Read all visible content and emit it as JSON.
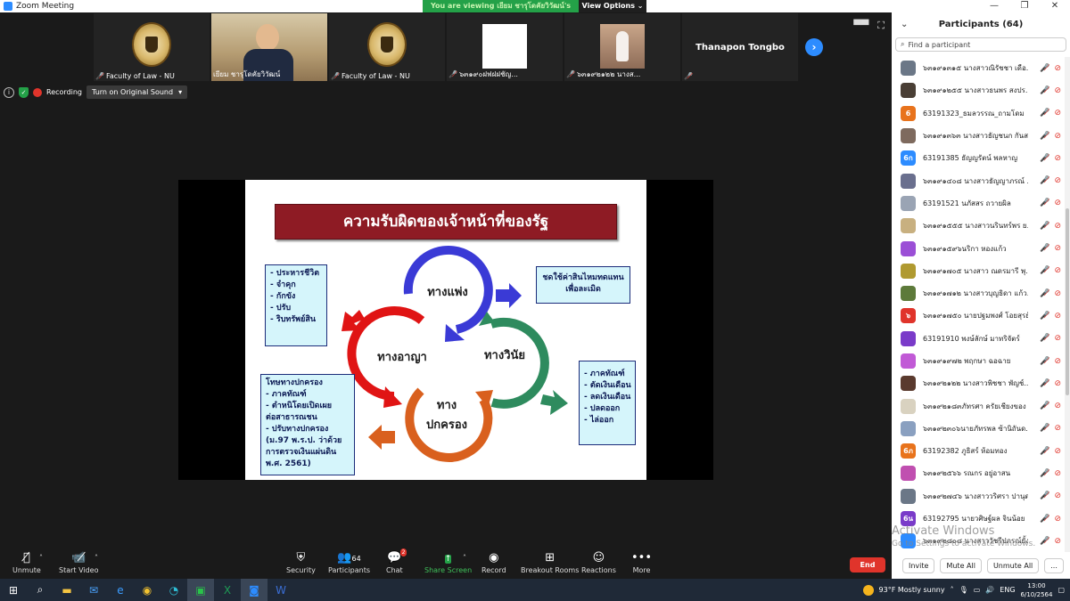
{
  "window": {
    "title": "Zoom Meeting",
    "controls": [
      "—",
      "❐",
      "✕"
    ]
  },
  "share_banner": {
    "viewing": "You are viewing เยียม ชารุโดคัยวิวัฒน์'s screen",
    "options": "View Options ⌄"
  },
  "gallery": [
    {
      "name": "Faculty of Law - NU",
      "kind": "seal"
    },
    {
      "name": "เยียม ชารุโดคัยวิวัฒน์",
      "kind": "person",
      "active": true
    },
    {
      "name": "Faculty of Law - NU",
      "kind": "seal"
    },
    {
      "name": "๖๓๑๙๐ฝฟฝฝชัญ...",
      "kind": "white"
    },
    {
      "name": "๖๓๑๙๒๑๒๒ นางส...",
      "kind": "girl"
    },
    {
      "name": "Thanapon Tongbo",
      "kind": "name"
    }
  ],
  "status_row": {
    "info_icon": "i",
    "recording": "Recording",
    "original_sound": "Turn on Original Sound"
  },
  "slide": {
    "title": "ความรับผิดของเจ้าหน้าที่ของรัฐ",
    "cycle": {
      "civil": "ทางแพ่ง",
      "criminal": "ทางอาญา",
      "discipline": "ทางวินัย",
      "admin_line1": "ทาง",
      "admin_line2": "ปกครอง"
    },
    "criminal_box": [
      "- ประหารชีวิต",
      "- จำคุก",
      "- กักขัง",
      "- ปรับ",
      "- ริบทรัพย์สิน"
    ],
    "civil_box": [
      "ชดใช้ค่าสินไหมทดแทน",
      "เพื่อละเมิด"
    ],
    "discipline_box": [
      "- ภาคทัณฑ์",
      "- ตัดเงินเดือน",
      "- ลดเงินเดือน",
      "- ปลดออก",
      "- ไล่ออก"
    ],
    "admin_box": [
      "โทษทางปกครอง",
      "- ภาคทัณฑ์",
      "- ตำหนิโดยเปิดเผย",
      "  ต่อสาธารณชน",
      "- ปรับทางปกครอง",
      "(ม.97  พ.ร.ป. ว่าด้วย",
      "การตรวจเงินแผ่นดิน",
      "พ.ศ. 2561)"
    ]
  },
  "participants_panel": {
    "title": "Participants (64)",
    "search_placeholder": "Find a participant",
    "participants": [
      {
        "initial": "",
        "color": "#6b7787",
        "name": "๖๓๑๙๑๓๑๕ นางสาวณิรัชชา เดือ..."
      },
      {
        "initial": "",
        "color": "#4a3f35",
        "name": "๖๓๑๙๑๒๕๕ นางสาวธนพร สงปร..."
      },
      {
        "initial": "6",
        "color": "#e8731c",
        "name": "63191323_ธมลวรรณ_ถามโดม"
      },
      {
        "initial": "",
        "color": "#7e6a5e",
        "name": "๖๓๑๙๑๓๖๓ นางสาวธัญชนก กันส..."
      },
      {
        "initial": "6ก",
        "color": "#2d8cff",
        "name": "63191385 ธัญญรัตน์ พลหาญ"
      },
      {
        "initial": "",
        "color": "#6a6f8e",
        "name": "๖๓๑๙๑๔๐๘ นางสาวธัญญาภรณ์ ..."
      },
      {
        "initial": "",
        "color": "#9aa4b4",
        "name": "63191521 นภัสสร ถวายผิล"
      },
      {
        "initial": "",
        "color": "#c8b080",
        "name": "๖๓๑๙๑๕๕๕ นางสาวนรินทร์พร ย..."
      },
      {
        "initial": "",
        "color": "#9b4fd6",
        "name": "๖๓๑๙๑๕๙๖นริกา หองแก้ว"
      },
      {
        "initial": "",
        "color": "#b09a30",
        "name": "๖๓๑๙๑๗๐๕ นางสาว ณดรมารี พุ..."
      },
      {
        "initial": "",
        "color": "#5d7a3a",
        "name": "๖๓๑๙๑๗๑๒ นางสาวบุญธิดา แก้ว..."
      },
      {
        "initial": "๖",
        "color": "#e0342b",
        "name": "๖๓๑๙๑๗๕๐ นายปฐมพงศ์ โอยสุรย์"
      },
      {
        "initial": "",
        "color": "#7a3bc9",
        "name": "63191910 พงษ์ลักษ์ มาทริจัตร์"
      },
      {
        "initial": "",
        "color": "#c15ad6",
        "name": "๖๓๑๙๑๙๗๒ พฤกษา ฉอฉาย"
      },
      {
        "initial": "",
        "color": "#5a3a2e",
        "name": "๖๓๑๙๒๑๒๒ นางสาวพิชชา พัญช์..."
      },
      {
        "initial": "",
        "color": "#d9d2c0",
        "name": "๖๓๑๙๒๑๘๓ภัทรศา ครัยเชียงของ"
      },
      {
        "initial": "",
        "color": "#8aa0c0",
        "name": "๖๓๑๙๒๓๐๖นายภัทรพล ซ้านิถันด..."
      },
      {
        "initial": "6ภ",
        "color": "#e8731c",
        "name": "63192382 ภูธิสร์ ห้อมทอง"
      },
      {
        "initial": "",
        "color": "#c04fb0",
        "name": "๖๓๑๙๒๕๖๖ รณกร อยู่อาสน"
      },
      {
        "initial": "",
        "color": "#6b7787",
        "name": "๖๓๑๙๒๗๔๖ นางสาววริศรา ปานุดร"
      },
      {
        "initial": "6น",
        "color": "#7a3bc9",
        "name": "63192795 นายวศิษฐ์ผล จินน้อย"
      },
      {
        "initial": "",
        "color": "#2d8cff",
        "name": "๖๓๑๙๒๘๐๘ นางสาววัชรีปภรณ์ยั้งนิ..."
      }
    ],
    "footer": [
      "Invite",
      "Mute All",
      "Unmute All",
      "..."
    ],
    "watermark_line1": "Activate Windows",
    "watermark_line2": "Go to Settings to activate Windows."
  },
  "toolbar": {
    "unmute": "Unmute",
    "start_video": "Start Video",
    "security": "Security",
    "participants": "Participants",
    "participants_count": "64",
    "chat": "Chat",
    "chat_badge": "2",
    "share_screen": "Share Screen",
    "record": "Record",
    "breakout": "Breakout Rooms",
    "reactions": "Reactions",
    "more": "More",
    "end": "End"
  },
  "taskbar": {
    "weather": "93°F  Mostly sunny",
    "lang": "ENG",
    "time": "13:00",
    "date": "6/10/2564"
  },
  "colors": {
    "slide_title_bg": "#8e1b24",
    "civil_arrow": "#3a3ad6",
    "criminal_arrow": "#e01414",
    "discipline_arrow": "#2e8b5e",
    "admin_arrow": "#d9601e",
    "zoom_blue": "#2d8cff",
    "end_red": "#e0342b"
  }
}
